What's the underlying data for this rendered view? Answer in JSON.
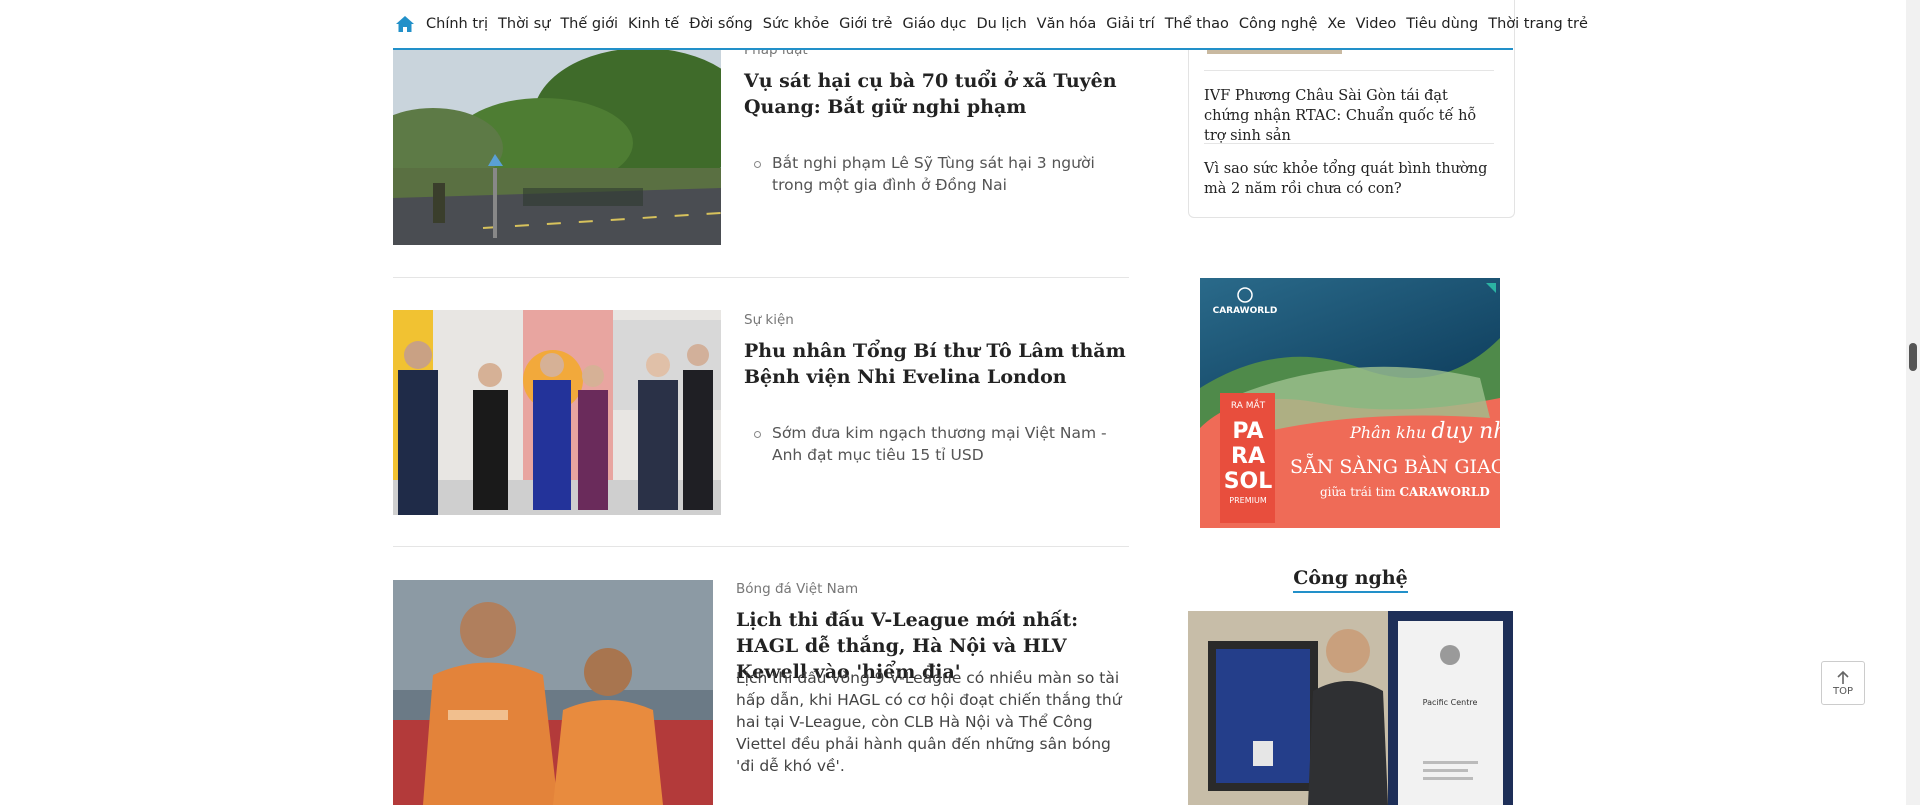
{
  "nav": {
    "items": [
      "Chính trị",
      "Thời sự",
      "Thế giới",
      "Kinh tế",
      "Đời sống",
      "Sức khỏe",
      "Giới trẻ",
      "Giáo dục",
      "Du lịch",
      "Văn hóa",
      "Giải trí",
      "Thể thao",
      "Công nghệ",
      "Xe",
      "Video",
      "Tiêu dùng",
      "Thời trang trẻ"
    ],
    "home_icon": "home-icon",
    "accent_color": "#2290c9"
  },
  "articles": [
    {
      "category": "Pháp luật",
      "title": "Vụ sát hại cụ bà 70 tuổi ở xã Tuyên Quang: Bắt giữ nghi phạm",
      "related": "Bắt nghi phạm Lê Sỹ Tùng sát hại 3 người trong một gia đình ở Đồng Nai"
    },
    {
      "category": "Sự kiện",
      "title": "Phu nhân Tổng Bí thư Tô Lâm thăm Bệnh viện Nhi Evelina London",
      "related": "Sớm đưa kim ngạch thương mại Việt Nam - Anh đạt mục tiêu 15 tỉ USD"
    },
    {
      "category": "Bóng đá Việt Nam",
      "title": "Lịch thi đấu V-League mới nhất: HAGL dễ thắng, Hà Nội và HLV Kewell vào 'hiểm địa'",
      "summary": "Lịch thi đấu vòng 9 V-League có nhiều màn so tài hấp dẫn, khi HAGL có cơ hội đoạt chiến thắng thứ hai tại V-League, còn CLB Hà Nội và Thể Công Viettel đều phải hành quân đến những sân bóng 'đi dễ khó về'."
    }
  ],
  "sidebar": {
    "links": [
      "IVF Phương Châu Sài Gòn tái đạt chứng nhận RTAC: Chuẩn quốc tế hỗ trợ sinh sản",
      "Vì sao sức khỏe tổng quát bình thường mà 2 năm rồi chưa có con?"
    ],
    "ad": {
      "brand": "CARAWORLD",
      "badge": "RA MẮT",
      "product_lines": [
        "PA",
        "RA",
        "SOL"
      ],
      "product_sub": "PREMIUM",
      "tagline_prefix": "Phân khu",
      "tagline_script": "duy nhất",
      "headline": "SẴN SÀNG BÀN GIAO",
      "subline_prefix": "giữa trái tim",
      "subline_brand": "CARAWORLD"
    },
    "section_title": "Công nghệ",
    "tech_card": {
      "place": "Pacific Centre"
    }
  },
  "top_button": "TOP"
}
